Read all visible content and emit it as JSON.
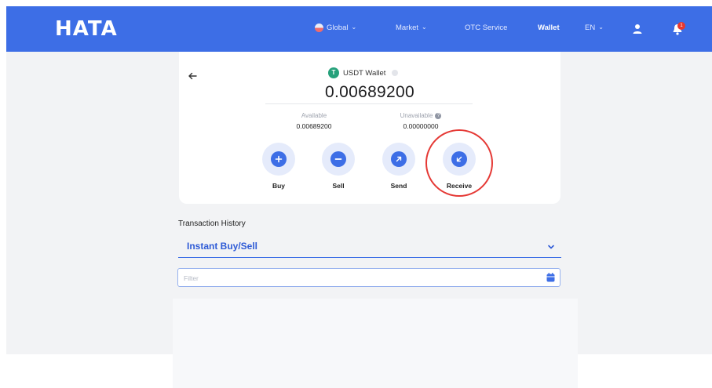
{
  "app": {
    "logo_text": "HATA"
  },
  "nav": {
    "global_label": "Global",
    "market_label": "Market",
    "otc_label": "OTC Service",
    "wallet_label": "Wallet",
    "lang_label": "EN",
    "notification_count": "1"
  },
  "wallet": {
    "title": "USDT Wallet",
    "coin_symbol": "T",
    "balance": "0.00689200",
    "available_label": "Available",
    "available_value": "0.00689200",
    "unavailable_label": "Unavailable",
    "unavailable_value": "0.00000000"
  },
  "actions": [
    {
      "label": "Buy",
      "icon": "plus-icon"
    },
    {
      "label": "Sell",
      "icon": "minus-icon"
    },
    {
      "label": "Send",
      "icon": "arrow-up-right-icon"
    },
    {
      "label": "Receive",
      "icon": "arrow-down-left-icon"
    }
  ],
  "transactions": {
    "heading": "Transaction History",
    "selected_type": "Instant Buy/Sell",
    "filter_placeholder": "Filter"
  },
  "colors": {
    "brand_blue": "#3d6ee6",
    "usdt_green": "#26a17b",
    "highlight_red": "#e53935"
  }
}
